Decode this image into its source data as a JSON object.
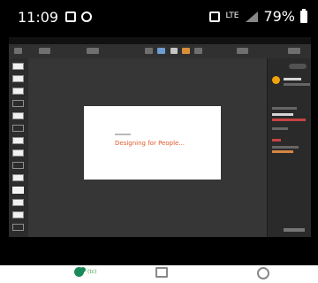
{
  "status_bar": {
    "time": "11:09",
    "network": "LTE",
    "battery": "79%"
  },
  "presentation": {
    "slide_title": "Designing for People..."
  },
  "bottom_nav": {
    "photos_label": "(tc)"
  }
}
